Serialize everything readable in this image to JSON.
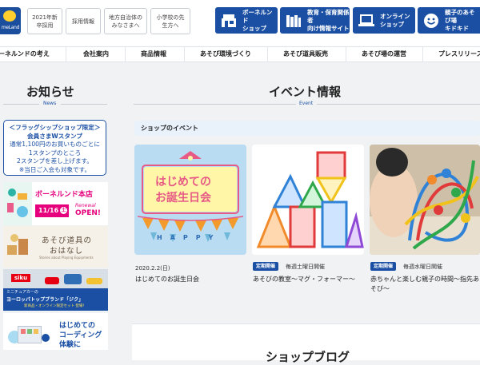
{
  "header": {
    "logo_text": "meLand",
    "links": [
      {
        "label": "2021年新\n卒採用"
      },
      {
        "label": "採用情報"
      },
      {
        "label": "地方自治体の\nみなさまへ"
      },
      {
        "label": "小学校の先\n生方へ"
      }
    ],
    "buttons": [
      {
        "label_1": "ボーネルンド",
        "label_2": "ショップ",
        "icon": "shop-icon"
      },
      {
        "label_1": "教育・保育関係者",
        "label_2": "向け情報サイト",
        "icon": "books-icon"
      },
      {
        "label_1": "オンライン",
        "label_2": "ショップ",
        "icon": "laptop-icon"
      },
      {
        "label_1": "親子のあそび場",
        "label_2": "キドキド",
        "icon": "smile-icon"
      }
    ],
    "accent": "#1a4fa4"
  },
  "nav": {
    "items": [
      "ーネルンドの考え",
      "会社案内",
      "商品情報",
      "あそび環境づくり",
      "あそび道具販売",
      "あそび場の運営",
      "プレスリリース"
    ]
  },
  "news": {
    "title": "お知らせ",
    "subtitle": "News",
    "notice_lines": [
      "＜フラッグシップショップ限定＞",
      "会員さまWスタンプ",
      "通常1,100円のお買いものごとに",
      "1スタンプのところ",
      "2スタンプを差し上げます。",
      "※当日ご入会も対象です。"
    ]
  },
  "banners": [
    {
      "name": "honten",
      "title": "ボーネルンド本店",
      "date": "11/16",
      "day": "土",
      "renewal": "Renewal",
      "open": "OPEN!"
    },
    {
      "name": "ohanashi",
      "title": "あそび道具の",
      "title2": "おはなし",
      "sub": "Stories about Playing Equipments"
    },
    {
      "name": "siku",
      "brand": "siku",
      "line1": "ミニチュアカーの",
      "line2": "ヨーロッパトップブランド「ジク」",
      "line3": "新商品・オンライン限定セット 登場！"
    },
    {
      "name": "coding",
      "line1": "はじめての",
      "line2": "コーディング",
      "line3": "体験に"
    }
  ],
  "events": {
    "title": "イベント情報",
    "subtitle": "Event",
    "shop_header": "ショップのイベント",
    "cards": [
      {
        "date": "2020.2.2(日)",
        "title": "はじめてのお誕生日会",
        "image_text_1": "はじめての",
        "image_text_2": "お誕生日会",
        "image_letters": "HAPPY"
      },
      {
        "tag": "定期開催",
        "schedule": "毎週土曜日開催",
        "title": "あそびの教室～マグ・フォーマー～"
      },
      {
        "tag": "定期開催",
        "schedule": "毎週水曜日開催",
        "title_1": "赤ちゃんと楽しむ親子の時間～指先あ",
        "title_2": "そび～"
      }
    ]
  },
  "blog": {
    "title": "ショップブログ"
  }
}
